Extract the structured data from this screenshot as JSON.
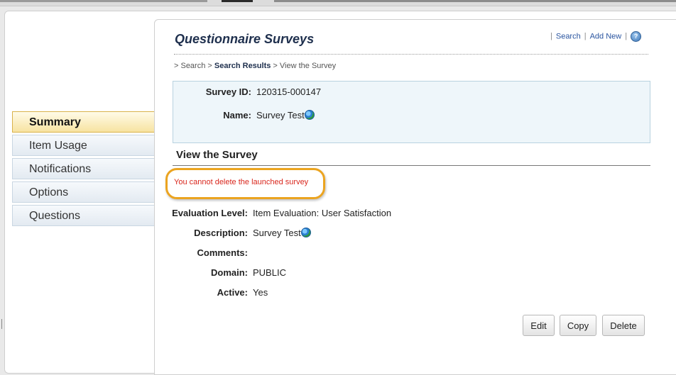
{
  "page": {
    "title": "Questionnaire Surveys"
  },
  "toplinks": {
    "sep": "|",
    "search": "Search",
    "add_new": "Add New",
    "help_glyph": "?"
  },
  "breadcrumb": {
    "prefix": "> Search > ",
    "current_parent": "Search Results",
    "suffix": " > View the Survey"
  },
  "sidebar": {
    "items": [
      {
        "label": "Summary",
        "active": true
      },
      {
        "label": "Item Usage",
        "active": false
      },
      {
        "label": "Notifications",
        "active": false
      },
      {
        "label": "Options",
        "active": false
      },
      {
        "label": "Questions",
        "active": false
      }
    ]
  },
  "survey": {
    "id_label": "Survey ID:",
    "id_value": "120315-000147",
    "name_label": "Name:",
    "name_value": "Survey Test"
  },
  "section": {
    "title": "View the Survey",
    "warning": "You cannot delete the launched survey"
  },
  "details": {
    "evaluation_label": "Evaluation Level:",
    "evaluation_value": "Item Evaluation: User Satisfaction",
    "description_label": "Description:",
    "description_value": "Survey Test",
    "comments_label": "Comments:",
    "comments_value": "",
    "domain_label": "Domain:",
    "domain_value": "PUBLIC",
    "active_label": "Active:",
    "active_value": "Yes"
  },
  "buttons": {
    "edit": "Edit",
    "copy": "Copy",
    "delete": "Delete"
  },
  "icons": {
    "globe": "globe-icon",
    "help": "help-icon"
  },
  "colors": {
    "warning_text": "#d9261c",
    "highlight_border": "#eba420",
    "active_tab": "#f7e3a1",
    "title_text": "#1e2f4d"
  }
}
